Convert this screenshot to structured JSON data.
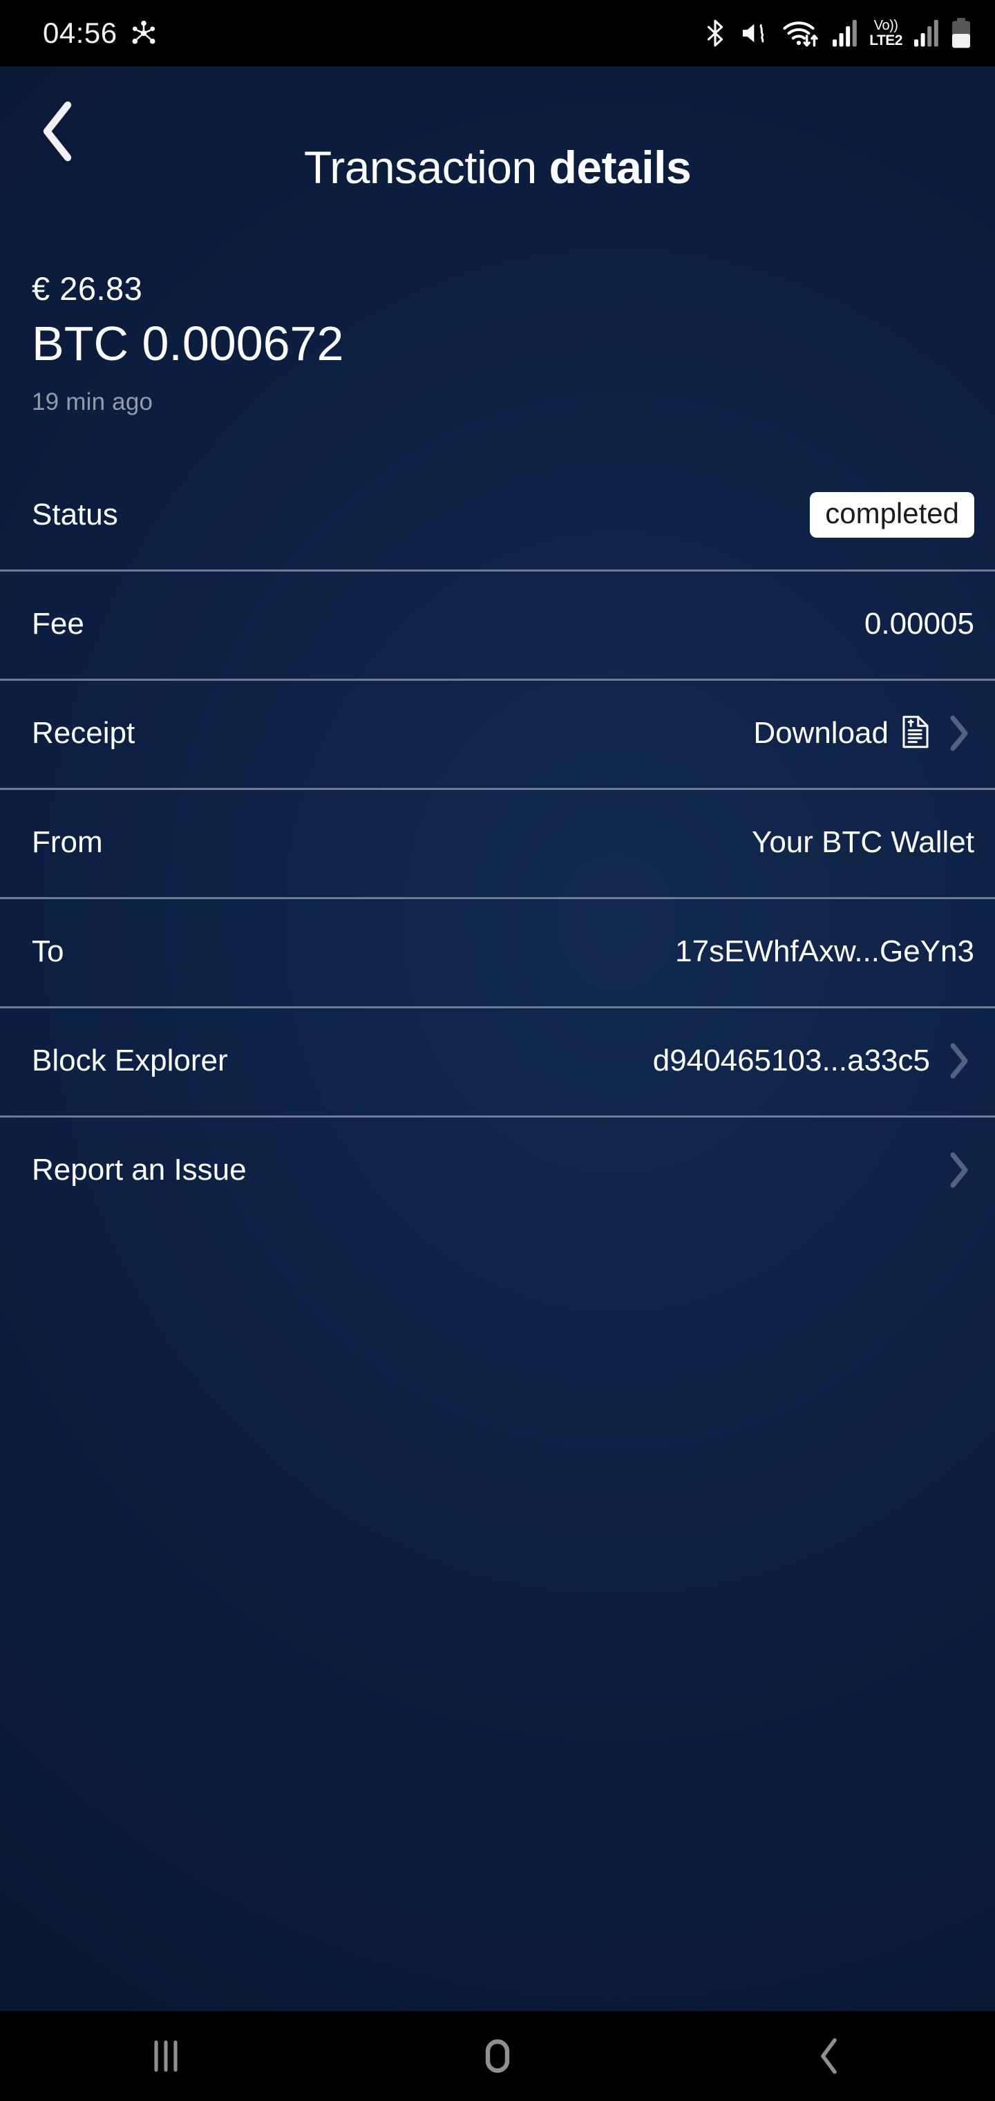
{
  "status_bar": {
    "clock": "04:56",
    "left_icons": [
      {
        "name": "network-hub-icon"
      }
    ],
    "right_icons": [
      {
        "name": "bluetooth-icon"
      },
      {
        "name": "vibrate-mute-icon"
      },
      {
        "name": "wifi-data-transfer-icon"
      },
      {
        "name": "signal-bars-sim1-icon"
      },
      {
        "name": "volte-indicator",
        "top": "Vo))",
        "bottom": "LTE2"
      },
      {
        "name": "signal-bars-sim2-icon"
      },
      {
        "name": "battery-icon"
      }
    ]
  },
  "header": {
    "back_label": "Back",
    "title_light": "Transaction",
    "title_bold": "details"
  },
  "summary": {
    "fiat_amount": "€ 26.83",
    "crypto_amount": "BTC 0.000672",
    "timestamp": "19 min ago"
  },
  "details": [
    {
      "label": "Status",
      "value": "completed",
      "value_kind": "badge",
      "has_chevron": false,
      "has_receipt_icon": false,
      "row_name": "detail-row-status"
    },
    {
      "label": "Fee",
      "value": "0.00005",
      "value_kind": "text",
      "has_chevron": false,
      "has_receipt_icon": false,
      "row_name": "detail-row-fee"
    },
    {
      "label": "Receipt",
      "value": "Download",
      "value_kind": "text",
      "has_chevron": true,
      "has_receipt_icon": true,
      "row_name": "detail-row-receipt"
    },
    {
      "label": "From",
      "value": "Your BTC Wallet",
      "value_kind": "text",
      "has_chevron": false,
      "has_receipt_icon": false,
      "row_name": "detail-row-from"
    },
    {
      "label": "To",
      "value": "17sEWhfAxw...GeYn3",
      "value_kind": "text",
      "has_chevron": false,
      "has_receipt_icon": false,
      "row_name": "detail-row-to"
    },
    {
      "label": "Block Explorer",
      "value": "d940465103...a33c5",
      "value_kind": "text",
      "has_chevron": true,
      "has_receipt_icon": false,
      "row_name": "detail-row-block-explorer"
    },
    {
      "label": "Report an Issue",
      "value": "",
      "value_kind": "text",
      "has_chevron": true,
      "has_receipt_icon": false,
      "row_name": "detail-row-report-issue"
    }
  ],
  "nav_bar": {
    "recents_label": "Recents",
    "home_label": "Home",
    "back_label": "Back"
  },
  "colors": {
    "background_top": "#12294f",
    "background_bottom": "#07152c",
    "separator": "#6d7d92",
    "badge_bg": "#ffffff",
    "badge_text": "#1b1b1b",
    "muted_text": "#949ca8",
    "chevron": "#52637d",
    "nav_icon": "#8f8f8f"
  }
}
